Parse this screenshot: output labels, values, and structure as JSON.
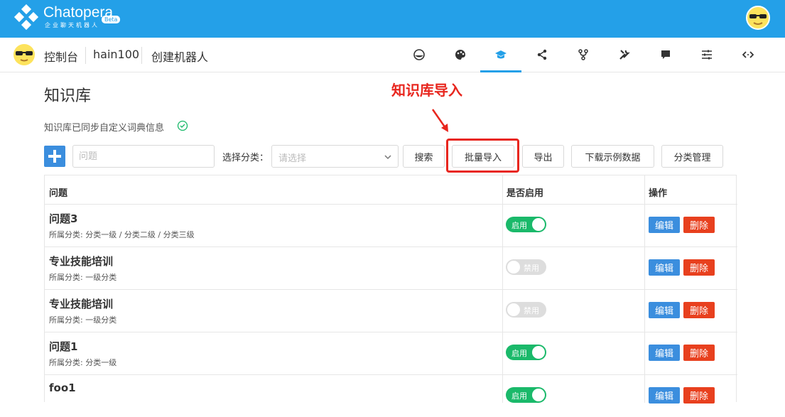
{
  "topbar": {
    "brand": "Chatopera",
    "brand_sub": "企业聊天机器人",
    "beta": "Beta",
    "color": "#24a0e8"
  },
  "subnav": {
    "console": "控制台",
    "bot_name": "hain100",
    "create_bot": "创建机器人",
    "icons": [
      "dashboard-icon",
      "palette-icon",
      "graduation-cap-icon",
      "share-icon",
      "fork-icon",
      "tools-icon",
      "chat-icon",
      "sliders-icon",
      "code-icon"
    ],
    "active_icon": "graduation-cap-icon"
  },
  "page": {
    "title": "知识库",
    "sync_info": "知识库已同步自定义词典信息"
  },
  "annotation": {
    "label": "知识库导入",
    "color": "#e8261e"
  },
  "toolbar": {
    "question_placeholder": "问题",
    "category_label": "选择分类：",
    "category_placeholder": "请选择",
    "search": "搜索",
    "batch_import": "批量导入",
    "export": "导出",
    "download_sample": "下载示例数据",
    "category_manage": "分类管理"
  },
  "table": {
    "headers": {
      "question": "问题",
      "enabled": "是否启用",
      "actions": "操作"
    },
    "rows": [
      {
        "title": "问题3",
        "category": "所属分类: 分类一级 / 分类二级 / 分类三级",
        "status": "启用",
        "enabled": true
      },
      {
        "title": "专业技能培训",
        "category": "所属分类: 一级分类",
        "status": "禁用",
        "enabled": false
      },
      {
        "title": "专业技能培训",
        "category": "所属分类: 一级分类",
        "status": "禁用",
        "enabled": false
      },
      {
        "title": "问题1",
        "category": "所属分类: 分类一级",
        "status": "启用",
        "enabled": true
      },
      {
        "title": "foo1",
        "category": "",
        "status": "启用",
        "enabled": true
      }
    ],
    "edit": "编辑",
    "delete": "删除"
  }
}
